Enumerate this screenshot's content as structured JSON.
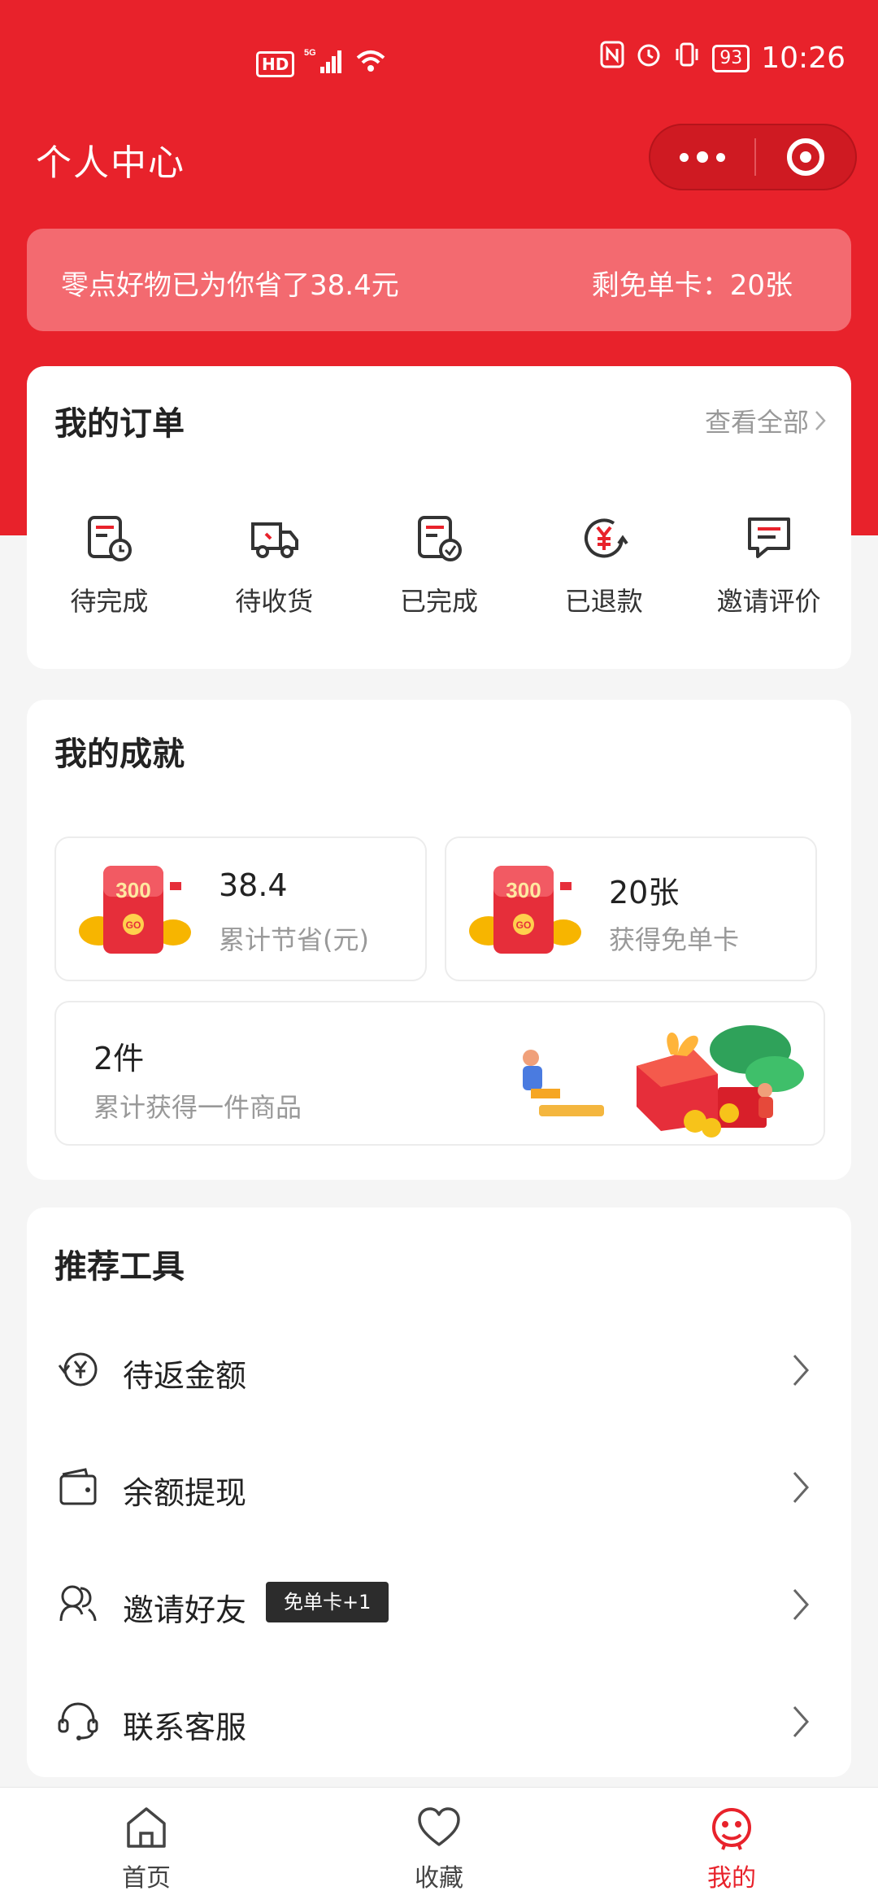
{
  "status_bar": {
    "hd": "HD",
    "network": "5G",
    "battery": "93",
    "time": "10:26"
  },
  "header": {
    "title": "个人中心"
  },
  "savings_banner": {
    "saved_text": "零点好物已为你省了38.4元",
    "cards_left_text": "剩免单卡：20张"
  },
  "orders": {
    "title": "我的订单",
    "view_all": "查看全部",
    "items": [
      {
        "label": "待完成",
        "icon": "pending-order-icon"
      },
      {
        "label": "待收货",
        "icon": "delivery-truck-icon"
      },
      {
        "label": "已完成",
        "icon": "completed-order-icon"
      },
      {
        "label": "已退款",
        "icon": "refund-icon"
      },
      {
        "label": "邀请评价",
        "icon": "review-icon"
      }
    ]
  },
  "achievements": {
    "title": "我的成就",
    "saved": {
      "value": "38.4",
      "label": "累计节省(元)"
    },
    "cards": {
      "value": "20张",
      "label": "获得免单卡"
    },
    "items": {
      "value": "2件",
      "label": "累计获得一件商品"
    },
    "redpack_text": "300",
    "redpack_go": "GO"
  },
  "tools": {
    "title": "推荐工具",
    "rows": [
      {
        "label": "待返金额",
        "icon": "yen-refresh-icon"
      },
      {
        "label": "余额提现",
        "icon": "wallet-icon"
      },
      {
        "label": "邀请好友",
        "icon": "friends-icon",
        "badge": "免单卡+1"
      },
      {
        "label": "联系客服",
        "icon": "headset-icon"
      }
    ]
  },
  "bottom_nav": {
    "items": [
      {
        "label": "首页",
        "icon": "home-icon",
        "active": false
      },
      {
        "label": "收藏",
        "icon": "heart-icon",
        "active": false
      },
      {
        "label": "我的",
        "icon": "profile-icon",
        "active": true
      }
    ]
  },
  "colors": {
    "brand_red": "#e8222b",
    "banner_pink": "#f36a70",
    "badge_dark": "#2c2c2c"
  }
}
